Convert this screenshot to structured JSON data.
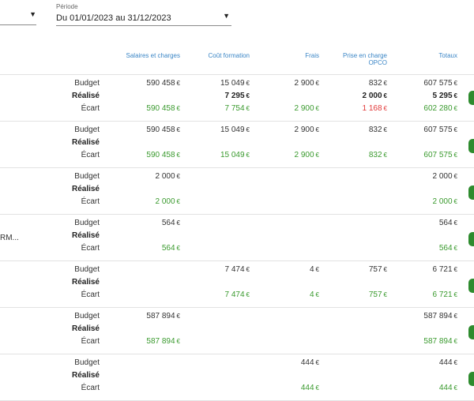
{
  "filters": {
    "periode_label": "Période",
    "periode_value": "Du 01/01/2023 au 31/12/2023",
    "dropdown_icon": "caret-down-icon"
  },
  "columns": [
    "Salaires et charges",
    "Coût formation",
    "Frais",
    "Prise en charge\nOPCO",
    "Totaux"
  ],
  "row_labels": {
    "budget": "Budget",
    "realise": "Réalisé",
    "ecart": "Écart"
  },
  "currency": "€",
  "colors": {
    "positive": "#3a9a2e",
    "negative": "#e23a3a",
    "header": "#3b86c6",
    "pill": "#2e8b2e"
  },
  "groups": [
    {
      "name": "",
      "budget": [
        "590 458",
        "15 049",
        "2 900",
        "832",
        "607 575"
      ],
      "realise": [
        "",
        "7 295",
        "",
        "2 000",
        "5 295"
      ],
      "ecart": [
        {
          "v": "590 458",
          "s": "pos"
        },
        {
          "v": "7 754",
          "s": "pos"
        },
        {
          "v": "2 900",
          "s": "pos"
        },
        {
          "v": "1 168",
          "s": "neg"
        },
        {
          "v": "602 280",
          "s": "pos"
        }
      ]
    },
    {
      "name": "",
      "budget": [
        "590 458",
        "15 049",
        "2 900",
        "832",
        "607 575"
      ],
      "realise": [
        "",
        "",
        "",
        "",
        ""
      ],
      "ecart": [
        {
          "v": "590 458",
          "s": "pos"
        },
        {
          "v": "15 049",
          "s": "pos"
        },
        {
          "v": "2 900",
          "s": "pos"
        },
        {
          "v": "832",
          "s": "pos"
        },
        {
          "v": "607 575",
          "s": "pos"
        }
      ]
    },
    {
      "name": "",
      "budget": [
        "2 000",
        "",
        "",
        "",
        "2 000"
      ],
      "realise": [
        "",
        "",
        "",
        "",
        ""
      ],
      "ecart": [
        {
          "v": "2 000",
          "s": "pos"
        },
        {
          "v": "",
          "s": "pos"
        },
        {
          "v": "",
          "s": "pos"
        },
        {
          "v": "",
          "s": "pos"
        },
        {
          "v": "2 000",
          "s": "pos"
        }
      ]
    },
    {
      "name": "RM...",
      "budget": [
        "564",
        "",
        "",
        "",
        "564"
      ],
      "realise": [
        "",
        "",
        "",
        "",
        ""
      ],
      "ecart": [
        {
          "v": "564",
          "s": "pos"
        },
        {
          "v": "",
          "s": "pos"
        },
        {
          "v": "",
          "s": "pos"
        },
        {
          "v": "",
          "s": "pos"
        },
        {
          "v": "564",
          "s": "pos"
        }
      ]
    },
    {
      "name": "",
      "budget": [
        "",
        "7 474",
        "4",
        "757",
        "6 721"
      ],
      "realise": [
        "",
        "",
        "",
        "",
        ""
      ],
      "ecart": [
        {
          "v": "",
          "s": "pos"
        },
        {
          "v": "7 474",
          "s": "pos"
        },
        {
          "v": "4",
          "s": "pos"
        },
        {
          "v": "757",
          "s": "pos"
        },
        {
          "v": "6 721",
          "s": "pos"
        }
      ]
    },
    {
      "name": "",
      "budget": [
        "587 894",
        "",
        "",
        "",
        "587 894"
      ],
      "realise": [
        "",
        "",
        "",
        "",
        ""
      ],
      "ecart": [
        {
          "v": "587 894",
          "s": "pos"
        },
        {
          "v": "",
          "s": "pos"
        },
        {
          "v": "",
          "s": "pos"
        },
        {
          "v": "",
          "s": "pos"
        },
        {
          "v": "587 894",
          "s": "pos"
        }
      ]
    },
    {
      "name": "",
      "budget": [
        "",
        "",
        "444",
        "",
        "444"
      ],
      "realise": [
        "",
        "",
        "",
        "",
        ""
      ],
      "ecart": [
        {
          "v": "",
          "s": "pos"
        },
        {
          "v": "",
          "s": "pos"
        },
        {
          "v": "444",
          "s": "pos"
        },
        {
          "v": "",
          "s": "pos"
        },
        {
          "v": "444",
          "s": "pos"
        }
      ]
    }
  ]
}
